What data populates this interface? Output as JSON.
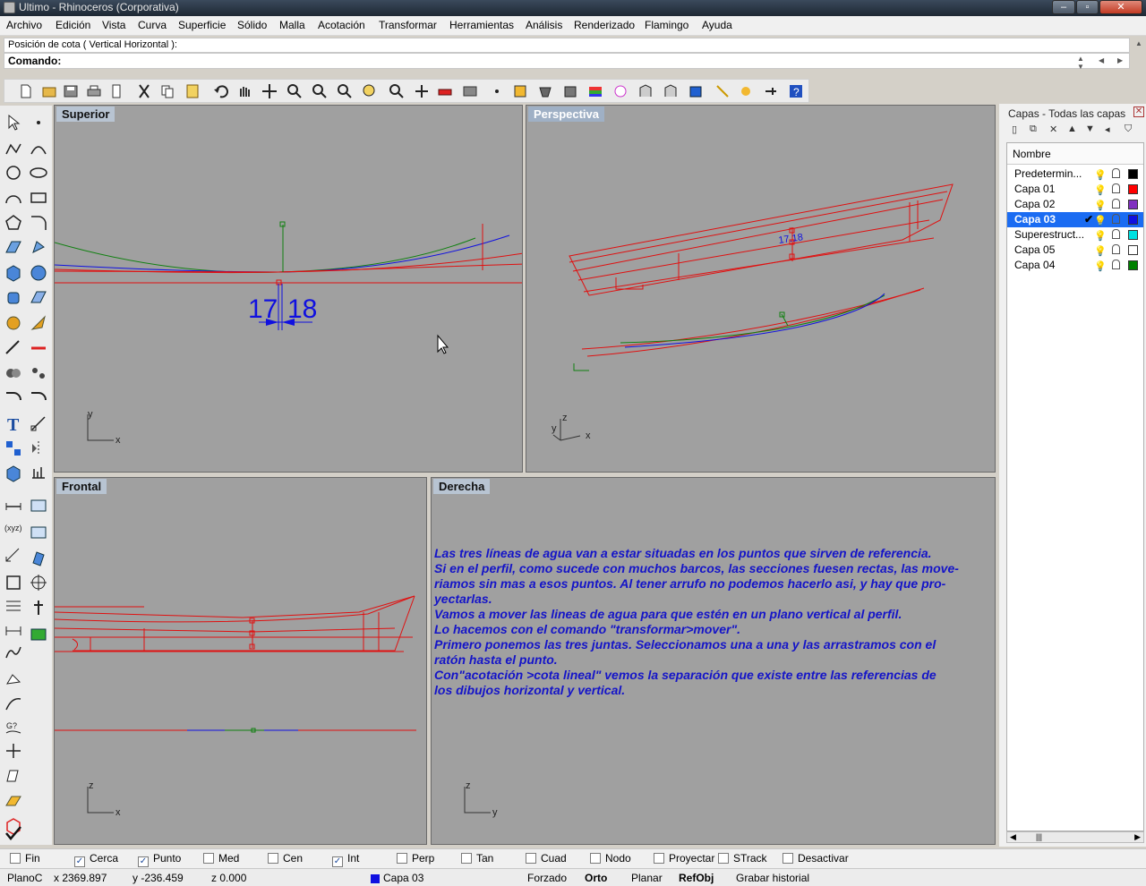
{
  "window": {
    "title": "Ultimo - Rhinoceros (Corporativa)"
  },
  "menu": [
    "Archivo",
    "Edición",
    "Vista",
    "Curva",
    "Superficie",
    "Sólido",
    "Malla",
    "Acotación",
    "Transformar",
    "Herramientas",
    "Análisis",
    "Renderizado",
    "Flamingo",
    "Ayuda"
  ],
  "command": {
    "history": "Posición de cota ( Vertical  Horizontal ):",
    "prompt_label": "Comando:",
    "input_value": ""
  },
  "viewports": {
    "top": {
      "title": "Superior",
      "dimension_left": "17",
      "dimension_right": "18",
      "axis_x": "x",
      "axis_y": "y"
    },
    "perspective": {
      "title": "Perspectiva",
      "dimension_label": "17.18",
      "axis_x": "x",
      "axis_y": "y",
      "axis_z": "z"
    },
    "front": {
      "title": "Frontal",
      "axis_x": "x",
      "axis_z": "z"
    },
    "right": {
      "title": "Derecha",
      "axis_y": "y",
      "axis_z": "z",
      "note_lines": [
        "Las tres líneas de agua van a estar situadas en los puntos que sirven de referencia.",
        "Si en el perfil, como sucede con muchos barcos, las secciones fuesen rectas, las move-",
        "riamos sin mas a esos puntos. Al tener arrufo no podemos hacerlo asi, y hay que pro-",
        "yectarlas.",
        "Vamos a mover las lineas de agua para que estén en un plano vertical al perfil.",
        "Lo hacemos con el comando \"transformar>mover\".",
        "Primero ponemos  las tres juntas. Seleccionamos una a una y las arrastramos con el",
        "ratón hasta el punto.",
        "Con\"acotación >cota lineal\"  vemos la separación que existe entre las referencias de",
        "los dibujos horizontal y vertical."
      ]
    }
  },
  "layers_panel": {
    "title": "Capas - Todas las capas",
    "column_header": "Nombre",
    "layers": [
      {
        "name": "Predetermin...",
        "color": "#000000",
        "current": false,
        "bulb": "yellow"
      },
      {
        "name": "Capa 01",
        "color": "#ff0000",
        "current": false,
        "bulb": "yellow"
      },
      {
        "name": "Capa 02",
        "color": "#8030c0",
        "current": false,
        "bulb": "yellow"
      },
      {
        "name": "Capa 03",
        "color": "#1010e0",
        "current": true,
        "bulb": "yellow"
      },
      {
        "name": "Superestruct...",
        "color": "#00e0e0",
        "current": false,
        "bulb": "blue"
      },
      {
        "name": "Capa 05",
        "color": "#ffffff",
        "current": false,
        "bulb": "yellow"
      },
      {
        "name": "Capa 04",
        "color": "#008000",
        "current": false,
        "bulb": "yellow"
      }
    ]
  },
  "osnaps": [
    {
      "label": "Fin",
      "checked": false
    },
    {
      "label": "Cerca",
      "checked": true
    },
    {
      "label": "Punto",
      "checked": true
    },
    {
      "label": "Med",
      "checked": false
    },
    {
      "label": "Cen",
      "checked": false
    },
    {
      "label": "Int",
      "checked": true
    },
    {
      "label": "Perp",
      "checked": false
    },
    {
      "label": "Tan",
      "checked": false
    },
    {
      "label": "Cuad",
      "checked": false
    },
    {
      "label": "Nodo",
      "checked": false
    },
    {
      "label": "Proyectar",
      "checked": false
    },
    {
      "label": "STrack",
      "checked": false
    },
    {
      "label": "Desactivar",
      "checked": false
    }
  ],
  "status": {
    "cplane": "PlanoC",
    "x": "x 2369.897",
    "y": "y -236.459",
    "z": "z 0.000",
    "layer": "Capa 03",
    "layer_color": "#1010e0",
    "forzado": "Forzado",
    "orto": "Orto",
    "planar": "Planar",
    "refobj": "RefObj",
    "history": "Grabar historial"
  },
  "colors": {
    "viewport_bg": "#a0a0a0",
    "curve_red": "#e01010",
    "curve_blue": "#1010e0",
    "curve_green": "#108010",
    "note_text": "#1414c8"
  }
}
